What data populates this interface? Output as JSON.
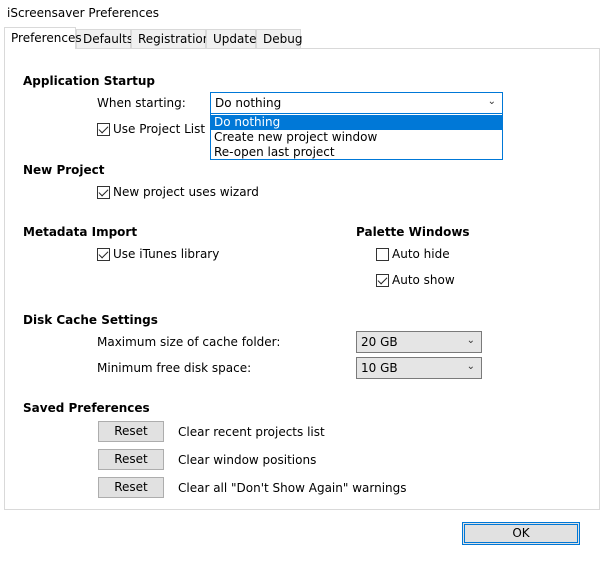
{
  "window": {
    "title": "iScreensaver Preferences"
  },
  "tabs": [
    {
      "label": "Preferences",
      "active": true
    },
    {
      "label": "Defaults",
      "active": false
    },
    {
      "label": "Registration",
      "active": false
    },
    {
      "label": "Update",
      "active": false
    },
    {
      "label": "Debug",
      "active": false
    }
  ],
  "app_startup": {
    "heading": "Application Startup",
    "when_starting_label": "When starting:",
    "when_starting_value": "Do nothing",
    "options": [
      "Do nothing",
      "Create new project window",
      "Re-open last project"
    ],
    "use_project_list_label": "Use Project List wi",
    "use_project_list_checked": true
  },
  "new_project": {
    "heading": "New Project",
    "wizard_label": "New project uses wizard",
    "wizard_checked": true
  },
  "metadata_import": {
    "heading": "Metadata Import",
    "itunes_label": "Use iTunes library",
    "itunes_checked": true
  },
  "palette_windows": {
    "heading": "Palette Windows",
    "auto_hide_label": "Auto hide",
    "auto_hide_checked": false,
    "auto_show_label": "Auto show",
    "auto_show_checked": true
  },
  "disk_cache": {
    "heading": "Disk Cache Settings",
    "max_size_label": "Maximum size of cache folder:",
    "max_size_value": "20 GB",
    "min_free_label": "Minimum free disk space:",
    "min_free_value": "10 GB"
  },
  "saved_prefs": {
    "heading": "Saved Preferences",
    "reset_label": "Reset",
    "items": [
      "Clear recent projects list",
      "Clear window positions",
      "Clear all \"Don't Show Again\" warnings"
    ]
  },
  "ok_label": "OK"
}
